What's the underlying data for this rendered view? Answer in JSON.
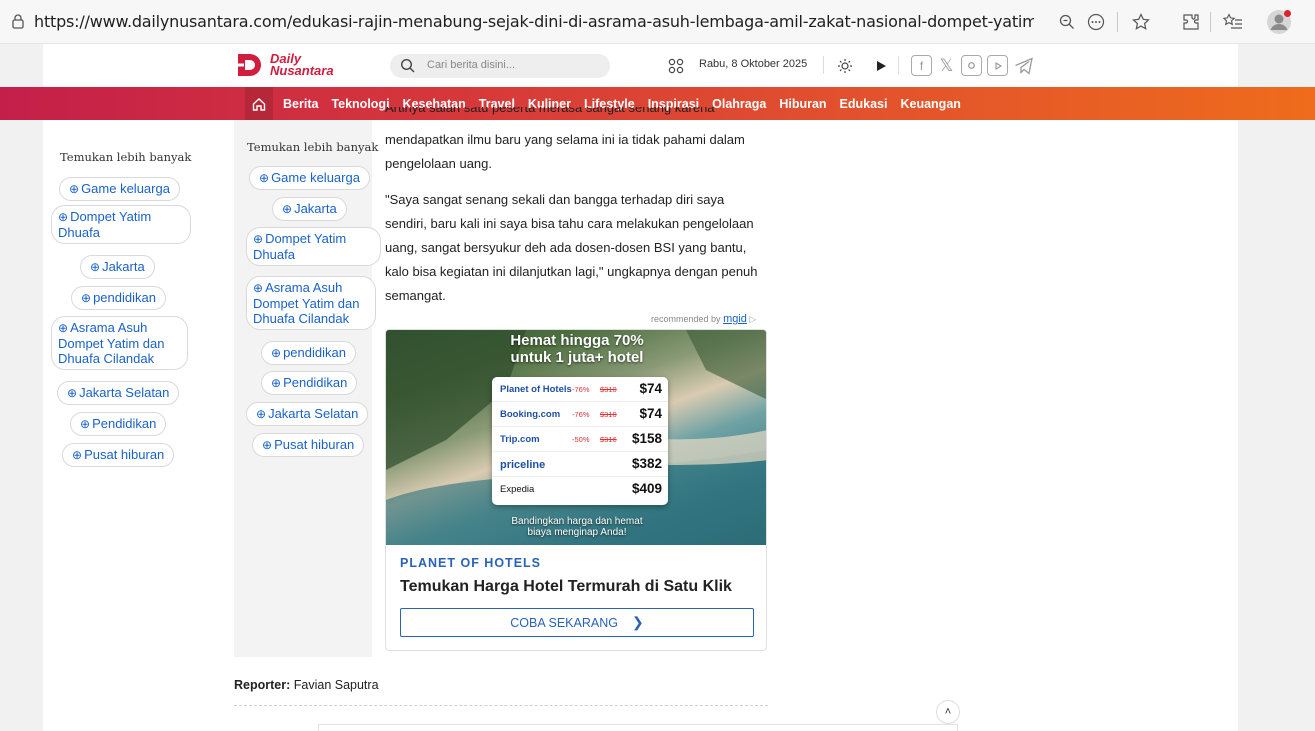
{
  "browser": {
    "url": "https://www.dailynusantara.com/edukasi-rajin-menabung-sejak-dini-di-asrama-asuh-lembaga-amil-zakat-nasional-dompet-yatim-dhuaf..."
  },
  "header": {
    "logo_line1": "Daily",
    "logo_line2": "Nusantara",
    "search_placeholder": "Cari berita disini...",
    "date": "Rabu, 8 Oktober 2025"
  },
  "nav": {
    "items": [
      "Berita",
      "Teknologi",
      "Kesehatan",
      "Travel",
      "Kuliner",
      "Lifestyle",
      "Inspirasi",
      "Olahraga",
      "Hiburan",
      "Edukasi",
      "Keuangan"
    ]
  },
  "tags_left": {
    "heading": "Temukan lebih banyak",
    "items": [
      "Game keluarga",
      "Dompet Yatim Dhuafa",
      "Jakarta",
      "pendidikan",
      "Asrama Asuh Dompet Yatim dan Dhuafa Cilandak",
      "Jakarta Selatan",
      "Pendidikan",
      "Pusat hiburan"
    ]
  },
  "tags_inner": {
    "heading": "Temukan lebih banyak",
    "items": [
      "Game keluarga",
      "Jakarta",
      "Dompet Yatim Dhuafa",
      "Asrama Asuh Dompet Yatim dan Dhuafa Cilandak",
      "pendidikan",
      "Pendidikan",
      "Jakarta Selatan",
      "Pusat hiburan"
    ]
  },
  "article": {
    "clipped_line": "Artinya salah satu peserta merasa sangat senang karena",
    "p1": "mendapatkan ilmu baru yang selama ini ia tidak pahami dalam pengelolaan uang.",
    "p2": "\"Saya sangat senang sekali dan bangga terhadap diri saya sendiri, baru kali ini saya bisa tahu cara melakukan pengelolaan uang, sangat bersyukur deh ada dosen-dosen BSI yang bantu, kalo bisa kegiatan ini dilanjutkan lagi,\" ungkapnya dengan penuh semangat."
  },
  "ad": {
    "recommended_by": "recommended by",
    "mgid": "mgid",
    "headline_1": "Hemat hingga 70%",
    "headline_2": "untuk 1 juta+ hotel",
    "rows": [
      {
        "name": "Planet of Hotels",
        "discount": "-76%",
        "old": "$310",
        "price": "$74"
      },
      {
        "name": "Booking.com",
        "discount": "-76%",
        "old": "$310",
        "price": "$74"
      },
      {
        "name": "Trip.com",
        "discount": "-50%",
        "old": "$316",
        "price": "$158"
      },
      {
        "name": "priceline",
        "discount": "",
        "old": "",
        "price": "$382"
      },
      {
        "name": "Expedia",
        "discount": "",
        "old": "",
        "price": "$409"
      }
    ],
    "caption_1": "Bandingkan harga dan hemat",
    "caption_2": "biaya menginap Anda!",
    "brand": "PLANET OF HOTELS",
    "title": "Temukan Harga Hotel Termurah di Satu Klik",
    "cta": "COBA SEKARANG"
  },
  "reporter": {
    "label": "Reporter:",
    "name": "Favian Saputra"
  }
}
